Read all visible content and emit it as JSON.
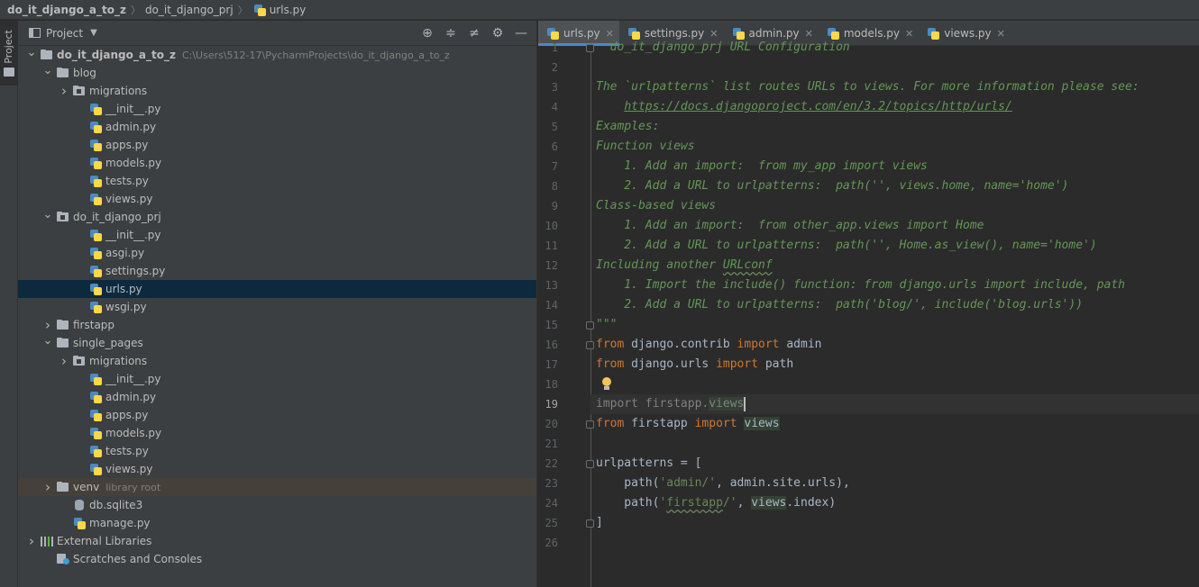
{
  "breadcrumb": [
    "do_it_django_a_to_z",
    "do_it_django_prj",
    "urls.py"
  ],
  "strip": {
    "project_tab": "Project"
  },
  "panel": {
    "title": "Project",
    "tools": [
      "locate-icon",
      "expand-all-icon",
      "collapse-all-icon",
      "gear-icon",
      "minimize-icon"
    ]
  },
  "tree": [
    {
      "label": "do_it_django_a_to_z",
      "hint": "C:\\Users\\512-17\\PycharmProjects\\do_it_django_a_to_z",
      "icon": "folder",
      "depth": 0,
      "arrow": "open",
      "bold": true
    },
    {
      "label": "blog",
      "icon": "folder",
      "depth": 1,
      "arrow": "open"
    },
    {
      "label": "migrations",
      "icon": "folder-pkg",
      "depth": 2,
      "arrow": "closed"
    },
    {
      "label": "__init__.py",
      "icon": "py",
      "depth": 3
    },
    {
      "label": "admin.py",
      "icon": "py",
      "depth": 3
    },
    {
      "label": "apps.py",
      "icon": "py",
      "depth": 3
    },
    {
      "label": "models.py",
      "icon": "py",
      "depth": 3
    },
    {
      "label": "tests.py",
      "icon": "py",
      "depth": 3
    },
    {
      "label": "views.py",
      "icon": "py",
      "depth": 3
    },
    {
      "label": "do_it_django_prj",
      "icon": "folder-pkg",
      "depth": 1,
      "arrow": "open"
    },
    {
      "label": "__init__.py",
      "icon": "py",
      "depth": 3
    },
    {
      "label": "asgi.py",
      "icon": "py",
      "depth": 3
    },
    {
      "label": "settings.py",
      "icon": "py",
      "depth": 3
    },
    {
      "label": "urls.py",
      "icon": "py",
      "depth": 3,
      "selected": true
    },
    {
      "label": "wsgi.py",
      "icon": "py",
      "depth": 3
    },
    {
      "label": "firstapp",
      "icon": "folder",
      "depth": 1,
      "arrow": "closed"
    },
    {
      "label": "single_pages",
      "icon": "folder",
      "depth": 1,
      "arrow": "open"
    },
    {
      "label": "migrations",
      "icon": "folder-pkg",
      "depth": 2,
      "arrow": "closed"
    },
    {
      "label": "__init__.py",
      "icon": "py",
      "depth": 3
    },
    {
      "label": "admin.py",
      "icon": "py",
      "depth": 3
    },
    {
      "label": "apps.py",
      "icon": "py",
      "depth": 3
    },
    {
      "label": "models.py",
      "icon": "py",
      "depth": 3
    },
    {
      "label": "tests.py",
      "icon": "py",
      "depth": 3
    },
    {
      "label": "views.py",
      "icon": "py",
      "depth": 3
    },
    {
      "label": "venv",
      "hint": "library root",
      "icon": "folder",
      "depth": 1,
      "arrow": "closed",
      "venv": true
    },
    {
      "label": "db.sqlite3",
      "icon": "db",
      "depth": 2
    },
    {
      "label": "manage.py",
      "icon": "py",
      "depth": 2
    },
    {
      "label": "External Libraries",
      "icon": "lib",
      "depth": 0,
      "arrow": "closed"
    },
    {
      "label": "Scratches and Consoles",
      "icon": "scratch",
      "depth": 1
    }
  ],
  "tabs": [
    {
      "label": "urls.py",
      "active": true
    },
    {
      "label": "settings.py"
    },
    {
      "label": "admin.py"
    },
    {
      "label": "models.py"
    },
    {
      "label": "views.py"
    }
  ],
  "editor": {
    "current_line": 19,
    "bulb_line": 18,
    "fold_lines": [
      1,
      15,
      16,
      20,
      22,
      25
    ],
    "lines": [
      {
        "n": 1,
        "tokens": [
          {
            "t": "  do_it_django_prj URL Configuration",
            "c": "doc"
          }
        ]
      },
      {
        "n": 2,
        "tokens": []
      },
      {
        "n": 3,
        "tokens": [
          {
            "t": "The `urlpatterns` list routes URLs to views. For more information please see:",
            "c": "doc"
          }
        ]
      },
      {
        "n": 4,
        "tokens": [
          {
            "t": "    ",
            "c": "doc"
          },
          {
            "t": "https://docs.djangoproject.com/en/3.2/topics/http/urls/",
            "c": "doclink"
          }
        ]
      },
      {
        "n": 5,
        "tokens": [
          {
            "t": "Examples:",
            "c": "doc"
          }
        ]
      },
      {
        "n": 6,
        "tokens": [
          {
            "t": "Function views",
            "c": "doc"
          }
        ]
      },
      {
        "n": 7,
        "tokens": [
          {
            "t": "    1. Add an import:  from my_app import views",
            "c": "doc"
          }
        ]
      },
      {
        "n": 8,
        "tokens": [
          {
            "t": "    2. Add a URL to urlpatterns:  path('', views.home, name='home')",
            "c": "doc"
          }
        ]
      },
      {
        "n": 9,
        "tokens": [
          {
            "t": "Class-based views",
            "c": "doc"
          }
        ]
      },
      {
        "n": 10,
        "tokens": [
          {
            "t": "    1. Add an import:  from other_app.views import Home",
            "c": "doc"
          }
        ]
      },
      {
        "n": 11,
        "tokens": [
          {
            "t": "    2. Add a URL to urlpatterns:  path('', Home.as_view(), name='home')",
            "c": "doc"
          }
        ]
      },
      {
        "n": 12,
        "tokens": [
          {
            "t": "Including another ",
            "c": "doc"
          },
          {
            "t": "URLconf",
            "c": "doc squig"
          }
        ]
      },
      {
        "n": 13,
        "tokens": [
          {
            "t": "    1. Import the include() function: from django.urls import include, path",
            "c": "doc"
          }
        ]
      },
      {
        "n": 14,
        "tokens": [
          {
            "t": "    2. Add a URL to urlpatterns:  path('blog/', include('blog.urls'))",
            "c": "doc"
          }
        ]
      },
      {
        "n": 15,
        "tokens": [
          {
            "t": "\"\"\"",
            "c": "doc"
          }
        ]
      },
      {
        "n": 16,
        "tokens": [
          {
            "t": "from",
            "c": "kw"
          },
          {
            "t": " django.contrib ",
            "c": ""
          },
          {
            "t": "import",
            "c": "kw"
          },
          {
            "t": " admin",
            "c": ""
          }
        ]
      },
      {
        "n": 17,
        "tokens": [
          {
            "t": "from",
            "c": "kw"
          },
          {
            "t": " django.urls ",
            "c": ""
          },
          {
            "t": "import",
            "c": "kw"
          },
          {
            "t": " path",
            "c": ""
          }
        ]
      },
      {
        "n": 18,
        "tokens": []
      },
      {
        "n": 19,
        "tokens": [
          {
            "t": "import firstapp.",
            "c": "unused"
          },
          {
            "t": "views",
            "c": "unused hl"
          },
          {
            "t": "",
            "c": "caret"
          }
        ]
      },
      {
        "n": 20,
        "tokens": [
          {
            "t": "from",
            "c": "kw"
          },
          {
            "t": " firstapp ",
            "c": ""
          },
          {
            "t": "import",
            "c": "kw"
          },
          {
            "t": " ",
            "c": ""
          },
          {
            "t": "views",
            "c": "hl"
          }
        ]
      },
      {
        "n": 21,
        "tokens": []
      },
      {
        "n": 22,
        "tokens": [
          {
            "t": "urlpatterns = [",
            "c": ""
          }
        ]
      },
      {
        "n": 23,
        "tokens": [
          {
            "t": "    path(",
            "c": ""
          },
          {
            "t": "'admin/'",
            "c": "str"
          },
          {
            "t": ", admin.site.urls),",
            "c": ""
          }
        ]
      },
      {
        "n": 24,
        "tokens": [
          {
            "t": "    path(",
            "c": ""
          },
          {
            "t": "'",
            "c": "str"
          },
          {
            "t": "firstapp",
            "c": "str squig"
          },
          {
            "t": "/'",
            "c": "str"
          },
          {
            "t": ", ",
            "c": ""
          },
          {
            "t": "views",
            "c": "hl"
          },
          {
            "t": ".index)",
            "c": ""
          }
        ]
      },
      {
        "n": 25,
        "tokens": [
          {
            "t": "]",
            "c": ""
          }
        ]
      },
      {
        "n": 26,
        "tokens": []
      }
    ]
  }
}
